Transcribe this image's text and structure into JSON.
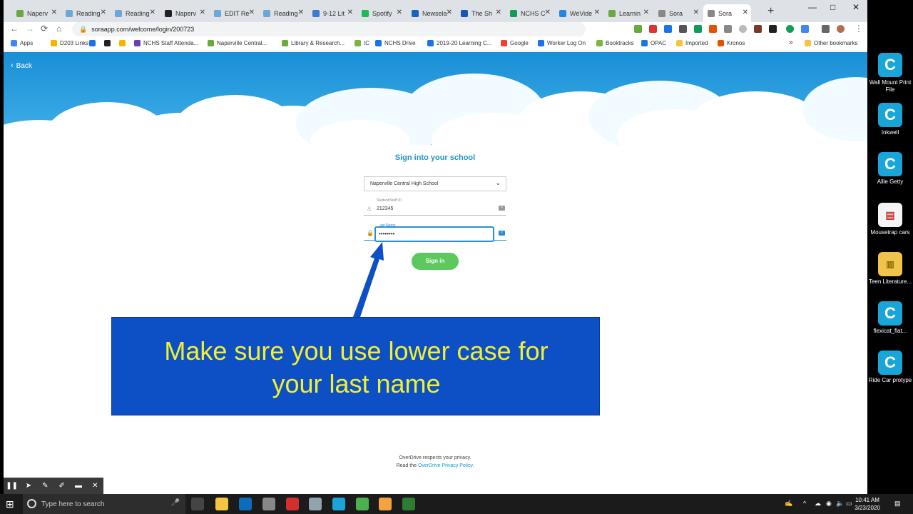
{
  "browser": {
    "tabs": [
      {
        "label": "Naperv",
        "color": "#6aaa3a"
      },
      {
        "label": "Reading",
        "color": "#6aa8d8"
      },
      {
        "label": "Reading",
        "color": "#6aa8d8"
      },
      {
        "label": "Naperv",
        "fav": "Bb",
        "color": "#222222"
      },
      {
        "label": "EDIT Re",
        "color": "#6aa8d8"
      },
      {
        "label": "Reading",
        "color": "#6aa8d8"
      },
      {
        "label": "9-12 Lit",
        "color": "#3a7bd5"
      },
      {
        "label": "Spotify",
        "color": "#1db954"
      },
      {
        "label": "Newsela",
        "color": "#1565c0"
      },
      {
        "label": "The Sh",
        "color": "#1a57b5"
      },
      {
        "label": "NCHS C",
        "color": "#0f9d58"
      },
      {
        "label": "WeVide",
        "color": "#1e88e5"
      },
      {
        "label": "Learnin",
        "color": "#6aaa3a"
      },
      {
        "label": "Sora",
        "color": "#888888"
      },
      {
        "label": "Sora",
        "color": "#888888",
        "active": true
      }
    ],
    "url": "soraapp.com/welcome/login/200723",
    "window_controls": {
      "minimize": "—",
      "maximize": "□",
      "close": "✕"
    },
    "nav": {
      "back": "←",
      "forward": "→",
      "reload": "⟳",
      "home": "⌂"
    },
    "bookmarks": [
      {
        "label": "Apps",
        "color": "#4285f4"
      },
      {
        "label": "D203 Links",
        "color": "#f4b400"
      },
      {
        "label": "",
        "color": "#1a73e8"
      },
      {
        "label": "",
        "color": "#222222"
      },
      {
        "label": "",
        "color": "#f4b400"
      },
      {
        "label": "NCHS Staff Attenda...",
        "color": "#6a3fb5"
      },
      {
        "label": "Naperville Central...",
        "color": "#6aaa3a"
      },
      {
        "label": "Library & Research...",
        "color": "#6aaa3a"
      },
      {
        "label": "IC",
        "color": "#7cb342"
      },
      {
        "label": "NCHS Drive",
        "color": "#1a73e8"
      },
      {
        "label": "2019-20 Learning C...",
        "color": "#1a73e8"
      },
      {
        "label": "Google",
        "color": "#ea4335"
      },
      {
        "label": "Worker Log On",
        "color": "#1a73e8"
      },
      {
        "label": "Booktracks",
        "color": "#7cb342"
      },
      {
        "label": "OPAC",
        "color": "#1a73e8"
      },
      {
        "label": "Imported",
        "color": "#f4c542"
      },
      {
        "label": "Kronos",
        "color": "#e65100"
      }
    ],
    "bookmarks_overflow": "»",
    "other_bookmarks": "Other bookmarks"
  },
  "page": {
    "back_label": "Back",
    "title": "Sign into your school",
    "school": "Naperville Central High School",
    "id_label": "Student/Staff ID",
    "id_value": "212345",
    "password_label": "ast Name",
    "password_value": "••••••••",
    "sign_in_label": "Sign in",
    "privacy_line1": "OverDrive respects your privacy.",
    "privacy_prefix": "Read the ",
    "privacy_link": "OverDrive Privacy Policy.",
    "callout_text_1": "Make sure you use lower case for",
    "callout_text_2": "your last name"
  },
  "desktop": {
    "icons": [
      {
        "label": "Wall Mount Print File",
        "icon": "canva-icon"
      },
      {
        "label": "Inkwell",
        "icon": "canva-icon"
      },
      {
        "label": "Allie Getty",
        "icon": "canva-icon"
      },
      {
        "label": "Mousetrap cars",
        "icon": "file-icon"
      },
      {
        "label": "Teen Literature...",
        "icon": "zip-folder-icon"
      },
      {
        "label": "flexicat_flat...",
        "icon": "canva-icon"
      },
      {
        "label": "Ride Car protype",
        "icon": "canva-icon"
      }
    ]
  },
  "taskbar": {
    "search_placeholder": "Type here to search",
    "time": "10:41 AM",
    "date": "3/23/2020",
    "apps": [
      {
        "name": "task-view",
        "color": "#444444"
      },
      {
        "name": "file-explorer",
        "color": "#f4c542"
      },
      {
        "name": "outlook",
        "color": "#0f6cbd"
      },
      {
        "name": "app-4",
        "color": "#888888"
      },
      {
        "name": "app-5",
        "color": "#d32f2f"
      },
      {
        "name": "app-6",
        "color": "#90a4ae"
      },
      {
        "name": "canva",
        "color": "#1aa5d8"
      },
      {
        "name": "chrome",
        "color": "#4caf50"
      },
      {
        "name": "app-9",
        "color": "#f4a340"
      },
      {
        "name": "app-10",
        "color": "#2e7d32"
      }
    ]
  },
  "annotation_toolbar": [
    "❚❚",
    "➤",
    "✎",
    "✐",
    "▬",
    "✕"
  ]
}
